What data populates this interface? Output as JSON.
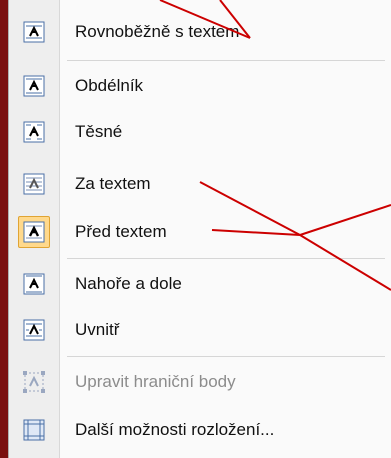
{
  "menu": {
    "items": [
      {
        "label": "Rovnoběžně s textem",
        "icon": "wrap-square-icon"
      },
      {
        "label": "Obdélník",
        "icon": "wrap-rectangle-icon"
      },
      {
        "label": "Těsné",
        "icon": "wrap-tight-icon"
      },
      {
        "label": "Za textem",
        "icon": "behind-text-icon"
      },
      {
        "label": "Před textem",
        "icon": "in-front-of-text-icon"
      },
      {
        "label": "Nahoře a dole",
        "icon": "top-bottom-icon"
      },
      {
        "label": "Uvnitř",
        "icon": "through-icon"
      },
      {
        "label": "Upravit hraniční body",
        "icon": "edit-wrap-points-icon"
      },
      {
        "label": "Další možnosti rozložení...",
        "icon": "more-layout-options-icon"
      }
    ]
  },
  "colors": {
    "background": "#7a0f0f",
    "highlight": "#ffd98c",
    "annotation_line": "#cc0000"
  }
}
